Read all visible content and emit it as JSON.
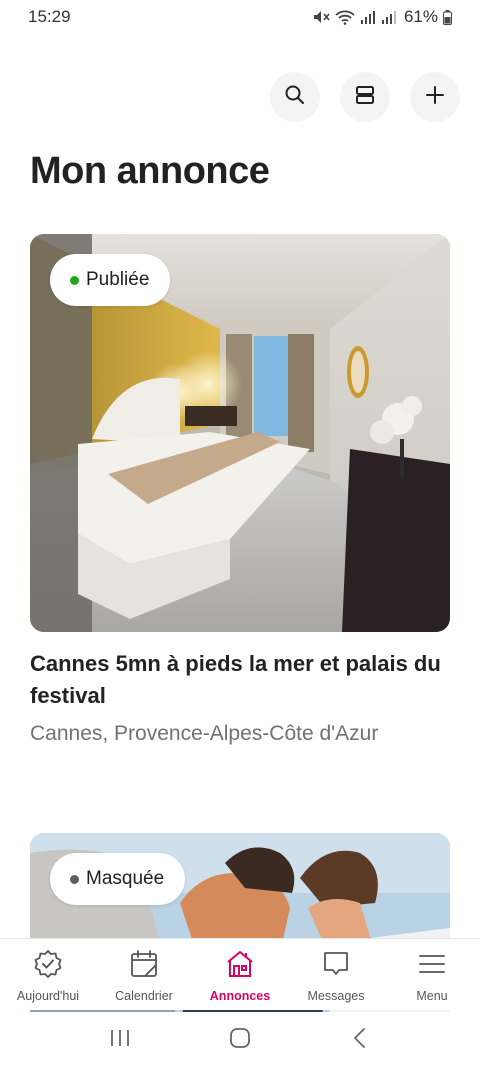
{
  "status_bar": {
    "time": "15:29",
    "battery": "61%",
    "icons": [
      "mute-icon",
      "wifi-icon",
      "signal-icon",
      "signal-icon",
      "battery-icon"
    ]
  },
  "header": {
    "title": "Mon annonce",
    "actions": [
      "search-icon",
      "layout-icon",
      "plus-icon"
    ]
  },
  "listings": [
    {
      "status": "Publiée",
      "status_color": "#1ea81e",
      "title": "Cannes 5mn à pieds la mer  et palais du festival",
      "location": "Cannes, Provence-Alpes-Côte d'Azur"
    },
    {
      "status": "Masquée",
      "status_color": "#5e5e5e"
    }
  ],
  "bottom_nav": {
    "accent": "#d70466",
    "items": [
      {
        "label": "Aujourd'hui",
        "icon": "checkbadge-icon"
      },
      {
        "label": "Calendrier",
        "icon": "calendar-icon"
      },
      {
        "label": "Annonces",
        "icon": "house-icon",
        "active": true
      },
      {
        "label": "Messages",
        "icon": "message-icon"
      },
      {
        "label": "Menu",
        "icon": "menu-icon"
      }
    ]
  },
  "system_nav": [
    "recents-icon",
    "home-icon",
    "back-icon"
  ]
}
